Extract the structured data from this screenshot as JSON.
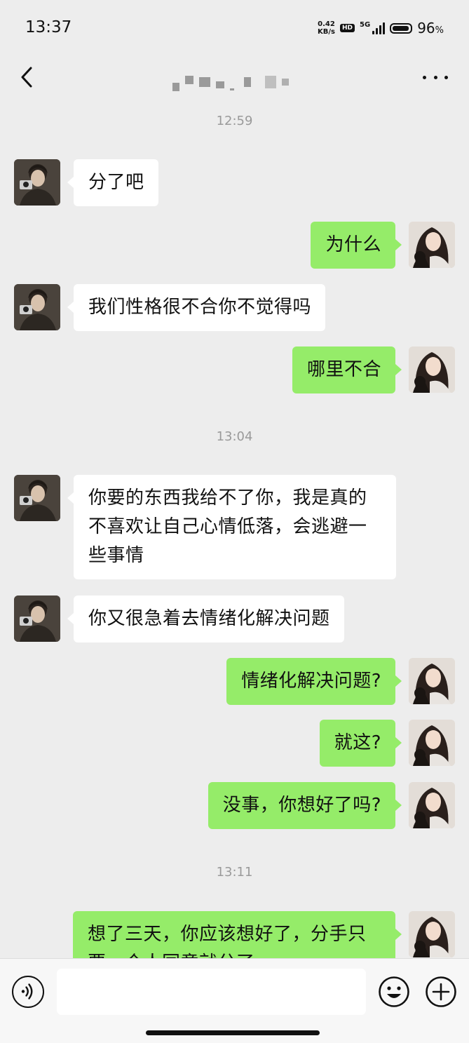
{
  "status_bar": {
    "time": "13:37",
    "net_speed_value": "0.42",
    "net_speed_unit": "KB/s",
    "hd_label": "HD",
    "network_label": "5G",
    "battery_percent": "96",
    "battery_unit": "%",
    "battery_level": 0.96
  },
  "header": {
    "back_icon": "chevron-left-icon",
    "contact_name": "",
    "more_icon": "more-horizontal-icon"
  },
  "chat": {
    "timestamps": [
      "12:59",
      "13:04",
      "13:11"
    ],
    "messages": [
      {
        "from": "other",
        "text": "分了吧"
      },
      {
        "from": "self",
        "text": "为什么"
      },
      {
        "from": "other",
        "text": "我们性格很不合你不觉得吗"
      },
      {
        "from": "self",
        "text": "哪里不合"
      },
      {
        "from": "other",
        "lines": [
          "你要的东西我给不了你，我是真的",
          "不喜欢让自己心情低落，会逃避一",
          "些事情"
        ]
      },
      {
        "from": "other",
        "text": "你又很急着去情绪化解决问题"
      },
      {
        "from": "self",
        "text": "情绪化解决问题?"
      },
      {
        "from": "self",
        "text": "就这?"
      },
      {
        "from": "self",
        "text": "没事，你想好了吗?"
      },
      {
        "from": "self",
        "lines": [
          "想了三天，你应该想好了，分手只",
          "要一个人同意就分了"
        ]
      }
    ]
  },
  "input_bar": {
    "voice_icon": "voice-icon",
    "message_placeholder": "",
    "emoji_icon": "emoji-icon",
    "plus_icon": "plus-circle-icon"
  },
  "colors": {
    "background": "#ededed",
    "self_bubble": "#95ec69",
    "other_bubble": "#ffffff",
    "timestamp_text": "#9a9a9a"
  }
}
